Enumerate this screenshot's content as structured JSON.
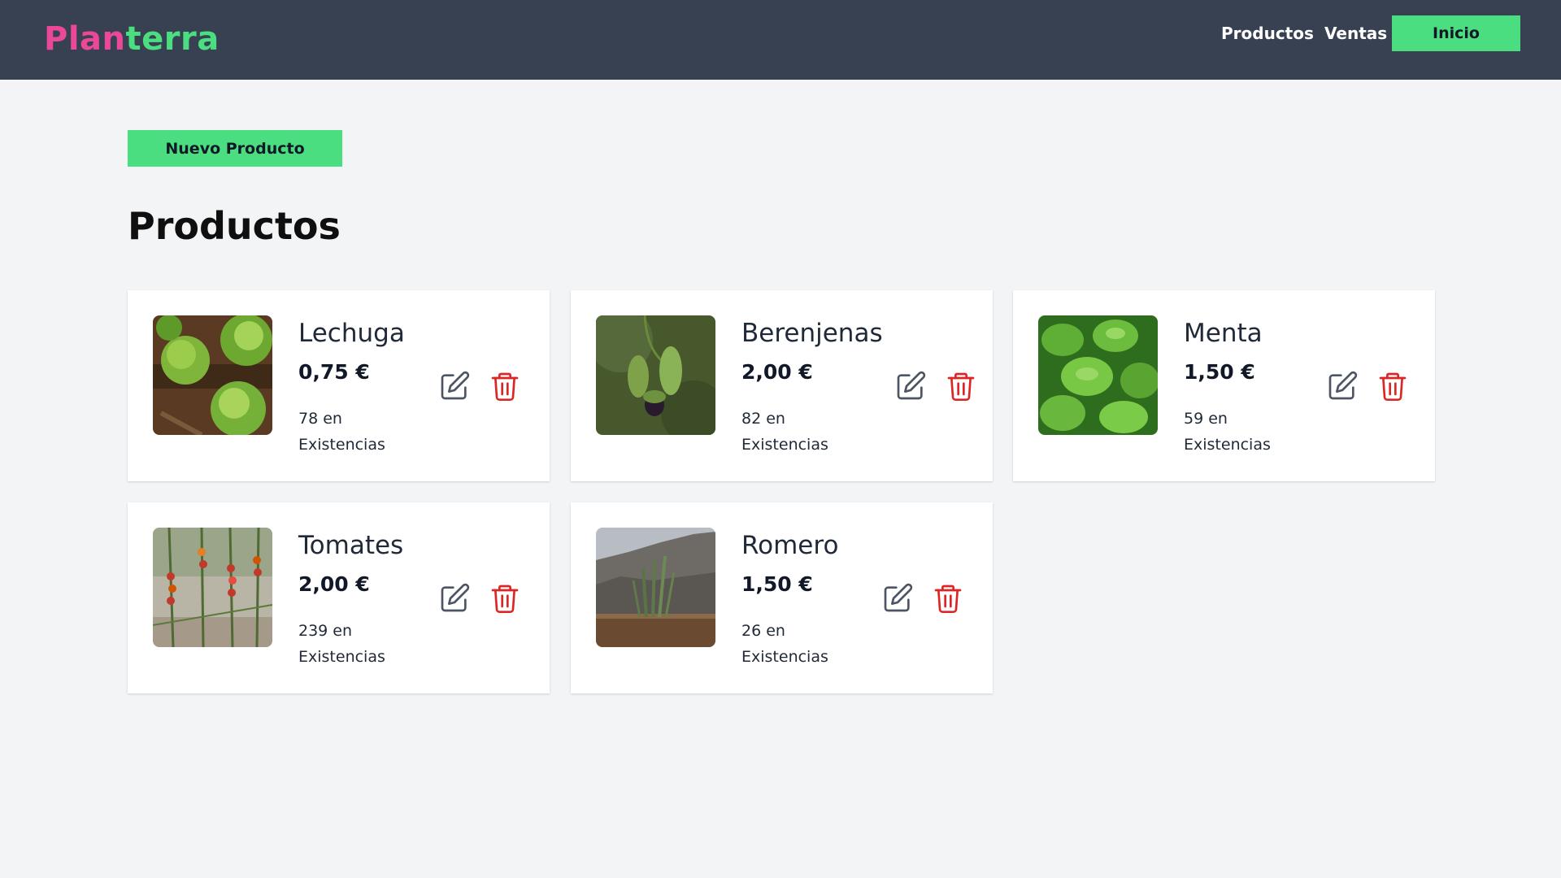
{
  "header": {
    "logo_part1": "Plan",
    "logo_part2": "terra",
    "nav": {
      "productos": "Productos",
      "ventas": "Ventas",
      "inicio": "Inicio"
    }
  },
  "main": {
    "new_product_button": "Nuevo Producto",
    "title": "Productos",
    "products": [
      {
        "name": "Lechuga",
        "price": "0,75 €",
        "stock_count": "78 en",
        "stock_label": "Existencias",
        "image": "lettuce-photo"
      },
      {
        "name": "Berenjenas",
        "price": "2,00 €",
        "stock_count": "82 en",
        "stock_label": "Existencias",
        "image": "eggplant-photo"
      },
      {
        "name": "Menta",
        "price": "1,50 €",
        "stock_count": "59 en",
        "stock_label": "Existencias",
        "image": "mint-photo"
      },
      {
        "name": "Tomates",
        "price": "2,00 €",
        "stock_count": "239 en",
        "stock_label": "Existencias",
        "image": "tomato-photo"
      },
      {
        "name": "Romero",
        "price": "1,50 €",
        "stock_count": "26 en",
        "stock_label": "Existencias",
        "image": "rosemary-photo"
      }
    ],
    "icons": {
      "edit": "edit-icon",
      "delete": "trash-icon"
    }
  },
  "colors": {
    "header_bg": "#374151",
    "accent_green": "#4ade80",
    "logo_pink": "#ec4899",
    "delete_red": "#dc2626",
    "page_bg": "#f3f4f6"
  }
}
